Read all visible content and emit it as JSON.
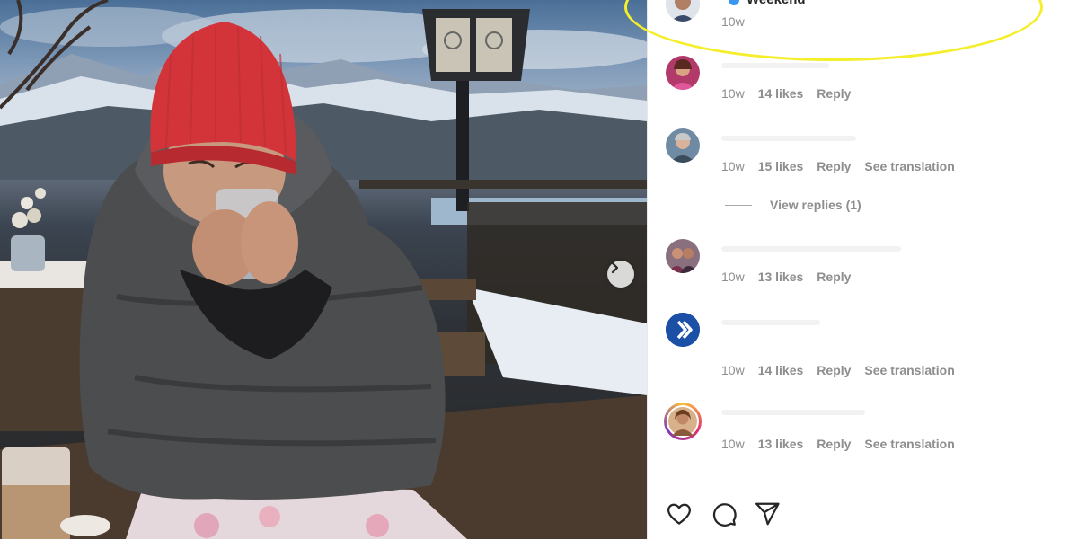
{
  "post": {
    "image_description_alt": "",
    "carousel_next_label": "›"
  },
  "caption": {
    "username": "",
    "text": "Weekend",
    "time": "10w"
  },
  "comments": [
    {
      "time": "10w",
      "likes": "14 likes",
      "reply": "Reply",
      "translate": ""
    },
    {
      "time": "10w",
      "likes": "15 likes",
      "reply": "Reply",
      "translate": "See translation"
    },
    {
      "time": "10w",
      "likes": "13 likes",
      "reply": "Reply",
      "translate": ""
    },
    {
      "time": "10w",
      "likes": "14 likes",
      "reply": "Reply",
      "translate": "See translation"
    },
    {
      "time": "10w",
      "likes": "13 likes",
      "reply": "Reply",
      "translate": "See translation"
    }
  ],
  "view_replies": "View replies (1)",
  "actions": {
    "like_icon": "heart-icon",
    "comment_icon": "comment-icon",
    "share_icon": "share-icon"
  },
  "colors": {
    "meta_text": "#8e8e8e",
    "highlight": "#f4ee2b",
    "verified": "#3897f0"
  }
}
